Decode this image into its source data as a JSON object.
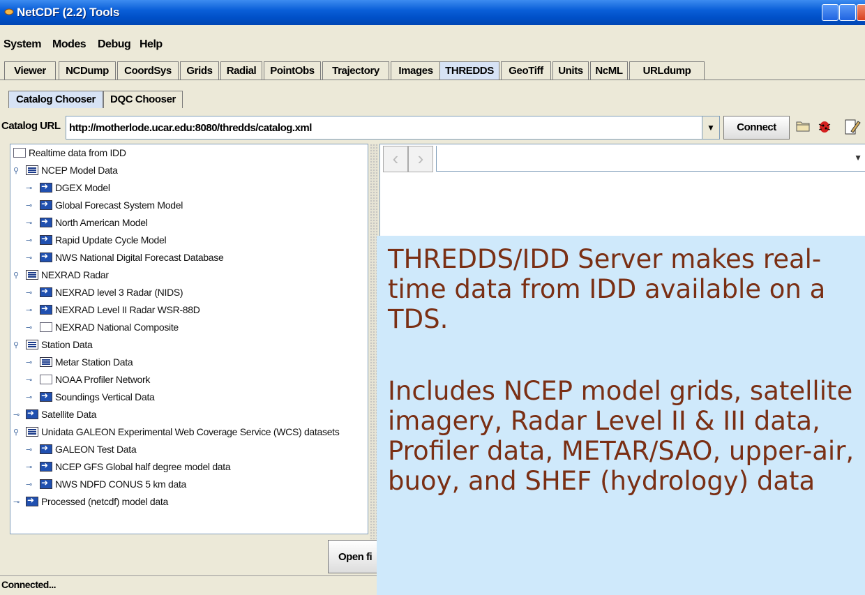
{
  "window": {
    "title": "NetCDF (2.2) Tools"
  },
  "menu": [
    "System",
    "Modes",
    "Debug",
    "Help"
  ],
  "tabs": [
    "Viewer",
    "NCDump",
    "CoordSys",
    "Grids",
    "Radial",
    "PointObs",
    "Trajectory",
    "Images",
    "THREDDS",
    "GeoTiff",
    "Units",
    "NcML",
    "URLdump"
  ],
  "selected_tab": "THREDDS",
  "subtabs": [
    "Catalog Chooser",
    "DQC Chooser"
  ],
  "catalog": {
    "label": "Catalog URL",
    "url": "http://motherlode.ucar.edu:8080/thredds/catalog.xml",
    "connect_label": "Connect"
  },
  "tree": [
    {
      "label": "Realtime data from IDD",
      "icon": "blank-folder-icon"
    },
    {
      "label": "NCEP Model Data",
      "icon": "list-folder-icon"
    },
    {
      "label": "DGEX Model",
      "icon": "dataset-arrow-icon"
    },
    {
      "label": "Global Forecast System Model",
      "icon": "dataset-arrow-icon"
    },
    {
      "label": "North American Model",
      "icon": "dataset-arrow-icon"
    },
    {
      "label": "Rapid Update Cycle Model",
      "icon": "dataset-arrow-icon"
    },
    {
      "label": "NWS National Digital Forecast Database",
      "icon": "dataset-arrow-icon"
    },
    {
      "label": "NEXRAD Radar",
      "icon": "list-folder-icon"
    },
    {
      "label": "NEXRAD level 3 Radar (NIDS)",
      "icon": "dataset-arrow-icon"
    },
    {
      "label": "NEXRAD Level II Radar WSR-88D",
      "icon": "dataset-arrow-icon"
    },
    {
      "label": "NEXRAD National Composite",
      "icon": "blank-folder-icon"
    },
    {
      "label": "Station Data",
      "icon": "list-folder-icon"
    },
    {
      "label": "Metar Station Data",
      "icon": "list-folder-icon"
    },
    {
      "label": "NOAA Profiler Network",
      "icon": "blank-folder-icon"
    },
    {
      "label": "Soundings Vertical Data",
      "icon": "dataset-arrow-icon"
    },
    {
      "label": "Satellite Data",
      "icon": "dataset-arrow-icon"
    },
    {
      "label": "Unidata GALEON Experimental Web Coverage Service (WCS) datasets",
      "icon": "list-folder-icon"
    },
    {
      "label": "GALEON Test Data",
      "icon": "dataset-arrow-icon"
    },
    {
      "label": "NCEP GFS Global half degree model data",
      "icon": "dataset-arrow-icon"
    },
    {
      "label": "NWS NDFD CONUS 5 km data",
      "icon": "dataset-arrow-icon"
    },
    {
      "label": "Processed (netcdf) model data",
      "icon": "dataset-arrow-icon"
    }
  ],
  "open_button_label": "Open fi",
  "status": "Connected...",
  "callout": {
    "paragraph1": "THREDDS/IDD Server makes real-time data from IDD available on a TDS.",
    "paragraph2": "Includes NCEP model grids, satellite imagery, Radar Level II & III data, Profiler data, METAR/SAO, upper-air, buoy, and SHEF (hydrology) data"
  },
  "colors": {
    "titlebar": "#0a5fd8",
    "window_bg": "#ece9d8",
    "callout_bg": "#cfe9fb",
    "callout_text": "#7a2f14",
    "selected_tab": "#d7e3f5"
  }
}
